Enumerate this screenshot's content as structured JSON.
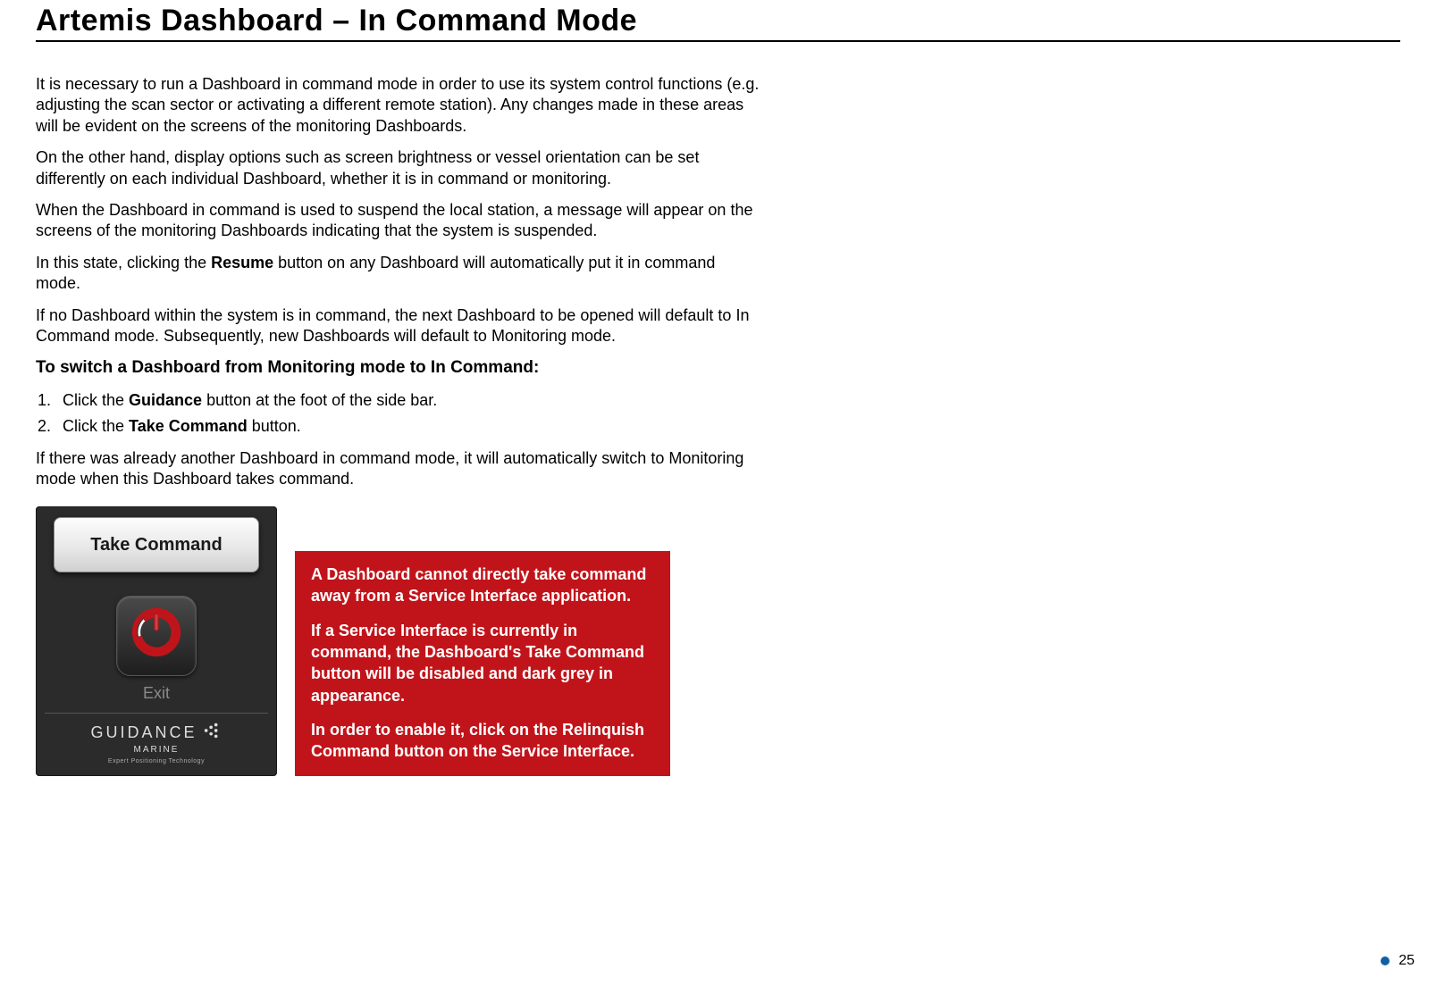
{
  "page": {
    "title": "Artemis Dashboard – In Command Mode",
    "number": "25"
  },
  "paragraphs": {
    "p1": "It is necessary to run a Dashboard in command mode in order to use its system control functions (e.g. adjusting the scan sector or activating a different remote station). Any changes made in these areas will be evident on the screens of the monitoring Dashboards.",
    "p2": "On the other hand, display options such as screen brightness or vessel orientation can be set differently on each individual Dashboard, whether it is in command or monitoring.",
    "p3": "When the Dashboard in command is used to suspend the local station, a message will appear on the screens of the monitoring Dashboards indicating that the system is suspended.",
    "p4a": "In this state, clicking the ",
    "p4b": "Resume",
    "p4c": " button on any Dashboard will automatically put it in command mode.",
    "p5": "If no Dashboard within the system is in command, the next Dashboard to be opened will default to In Command mode. Subsequently, new Dashboards will default to Monitoring mode.",
    "subhead": "To switch a Dashboard from Monitoring mode to In Command:",
    "li1a": "Click the ",
    "li1b": "Guidance",
    "li1c": " button at the foot of the side bar.",
    "li2a": "Click the ",
    "li2b": "Take Command",
    "li2c": " button.",
    "p6": "If there was already another Dashboard in command mode, it will automatically switch to Monitoring mode when this Dashboard takes command."
  },
  "panel": {
    "take_command_label": "Take Command",
    "exit_label": "Exit",
    "brand_main": "GUIDANCE",
    "brand_sub": "MARINE",
    "brand_tag": "Expert Positioning Technology"
  },
  "callout": {
    "c1": "A  Dashboard cannot directly take command away from a Service Interface application.",
    "c2": "If a Service Interface is currently in command, the Dashboard's Take Command button will be disabled and dark grey in appearance.",
    "c3": "In order to enable it, click on the Relinquish Command button on the Service Interface."
  }
}
